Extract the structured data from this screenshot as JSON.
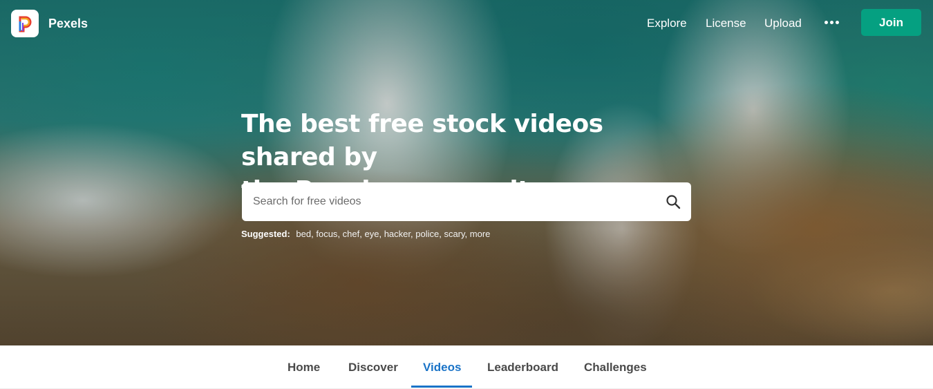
{
  "brand": {
    "name": "Pexels",
    "logo_icon": "pexels-logo-icon"
  },
  "nav": {
    "links": [
      "Explore",
      "License",
      "Upload"
    ],
    "more_icon": "more-dots-icon",
    "join_label": "Join"
  },
  "hero": {
    "headline_line1": "The best free stock videos shared by",
    "headline_line2": "the Pexels community."
  },
  "search": {
    "placeholder": "Search for free videos",
    "value": "",
    "icon": "search-icon"
  },
  "suggested": {
    "label": "Suggested:",
    "items": [
      "bed",
      "focus",
      "chef",
      "eye",
      "hacker",
      "police",
      "scary",
      "more"
    ]
  },
  "tabs": {
    "items": [
      "Home",
      "Discover",
      "Videos",
      "Leaderboard",
      "Challenges"
    ],
    "active": "Videos"
  },
  "colors": {
    "accent_green": "#05a081",
    "active_tab_blue": "#1a73c7"
  }
}
